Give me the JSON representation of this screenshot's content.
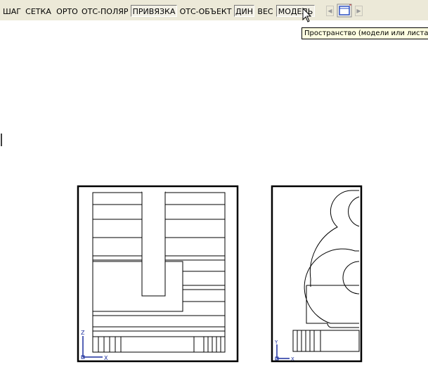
{
  "statusbar": {
    "buttons": [
      {
        "label": "ШАГ",
        "pressed": false
      },
      {
        "label": "СЕТКА",
        "pressed": false
      },
      {
        "label": "ОРТО",
        "pressed": false
      },
      {
        "label": "ОТС-ПОЛЯР",
        "pressed": false
      },
      {
        "label": "ПРИВЯЗКА",
        "pressed": true
      },
      {
        "label": "ОТС-ОБЪЕКТ",
        "pressed": false
      },
      {
        "label": "ДИН",
        "pressed": true
      },
      {
        "label": "ВЕС",
        "pressed": false
      },
      {
        "label": "МОДЕЛЬ",
        "pressed": true
      }
    ],
    "scroll_left_icon": "arrow-left-icon",
    "scroll_right_icon": "arrow-right-icon",
    "layout_icon": "viewport-layout-icon"
  },
  "tooltip": {
    "text": "Пространство (модели или листа)"
  },
  "viewports": [
    {
      "ucs": {
        "y_label": "Z",
        "x_label": "X"
      }
    },
    {
      "ucs": {
        "y_label": "Y",
        "x_label": "X"
      }
    }
  ],
  "colors": {
    "toolbar_bg": "#ece9d8",
    "tooltip_bg": "#ffffe1",
    "canvas_bg": "#ffffff",
    "ucs_color": "#1c2f9e"
  }
}
